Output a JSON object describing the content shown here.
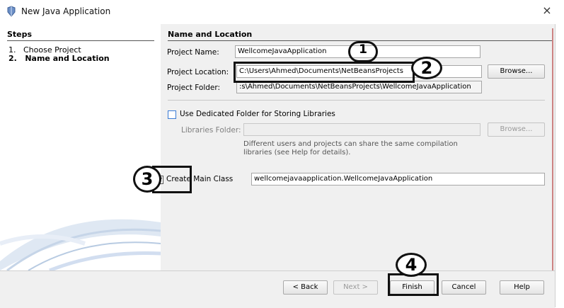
{
  "window": {
    "title": "New Java Application",
    "close_glyph": "×"
  },
  "steps": {
    "heading": "Steps",
    "items": [
      {
        "num": "1.",
        "label": "Choose Project"
      },
      {
        "num": "2.",
        "label": "Name and Location"
      }
    ]
  },
  "panel": {
    "heading": "Name and Location",
    "project_name": {
      "label": "Project Name:",
      "value": "WellcomeJavaApplication"
    },
    "project_location": {
      "label": "Project Location:",
      "value": "C:\\Users\\Ahmed\\Documents\\NetBeansProjects",
      "browse": "Browse..."
    },
    "project_folder": {
      "label": "Project Folder:",
      "value": ":s\\Ahmed\\Documents\\NetBeansProjects\\WellcomeJavaApplication"
    },
    "dedicated_folder": {
      "label": "Use Dedicated Folder for Storing Libraries",
      "checked": false
    },
    "libraries_folder": {
      "label": "Libraries Folder:",
      "value": "",
      "browse": "Browse..."
    },
    "libraries_note": [
      "Different users and projects can share the same compilation",
      "libraries (see Help for details)."
    ],
    "main_class": {
      "label": "Create Main Class",
      "value": "wellcomejavaapplication.WellcomeJavaApplication",
      "checked": true
    }
  },
  "buttons": {
    "back": "< Back",
    "next": "Next >",
    "finish": "Finish",
    "cancel": "Cancel",
    "help": "Help"
  },
  "annotations": [
    "1",
    "2",
    "3",
    "4"
  ],
  "colors": {
    "panel_bg": "#f0f0f0",
    "checkbox_accent": "#3a7bd5",
    "annotation": "#111111"
  }
}
